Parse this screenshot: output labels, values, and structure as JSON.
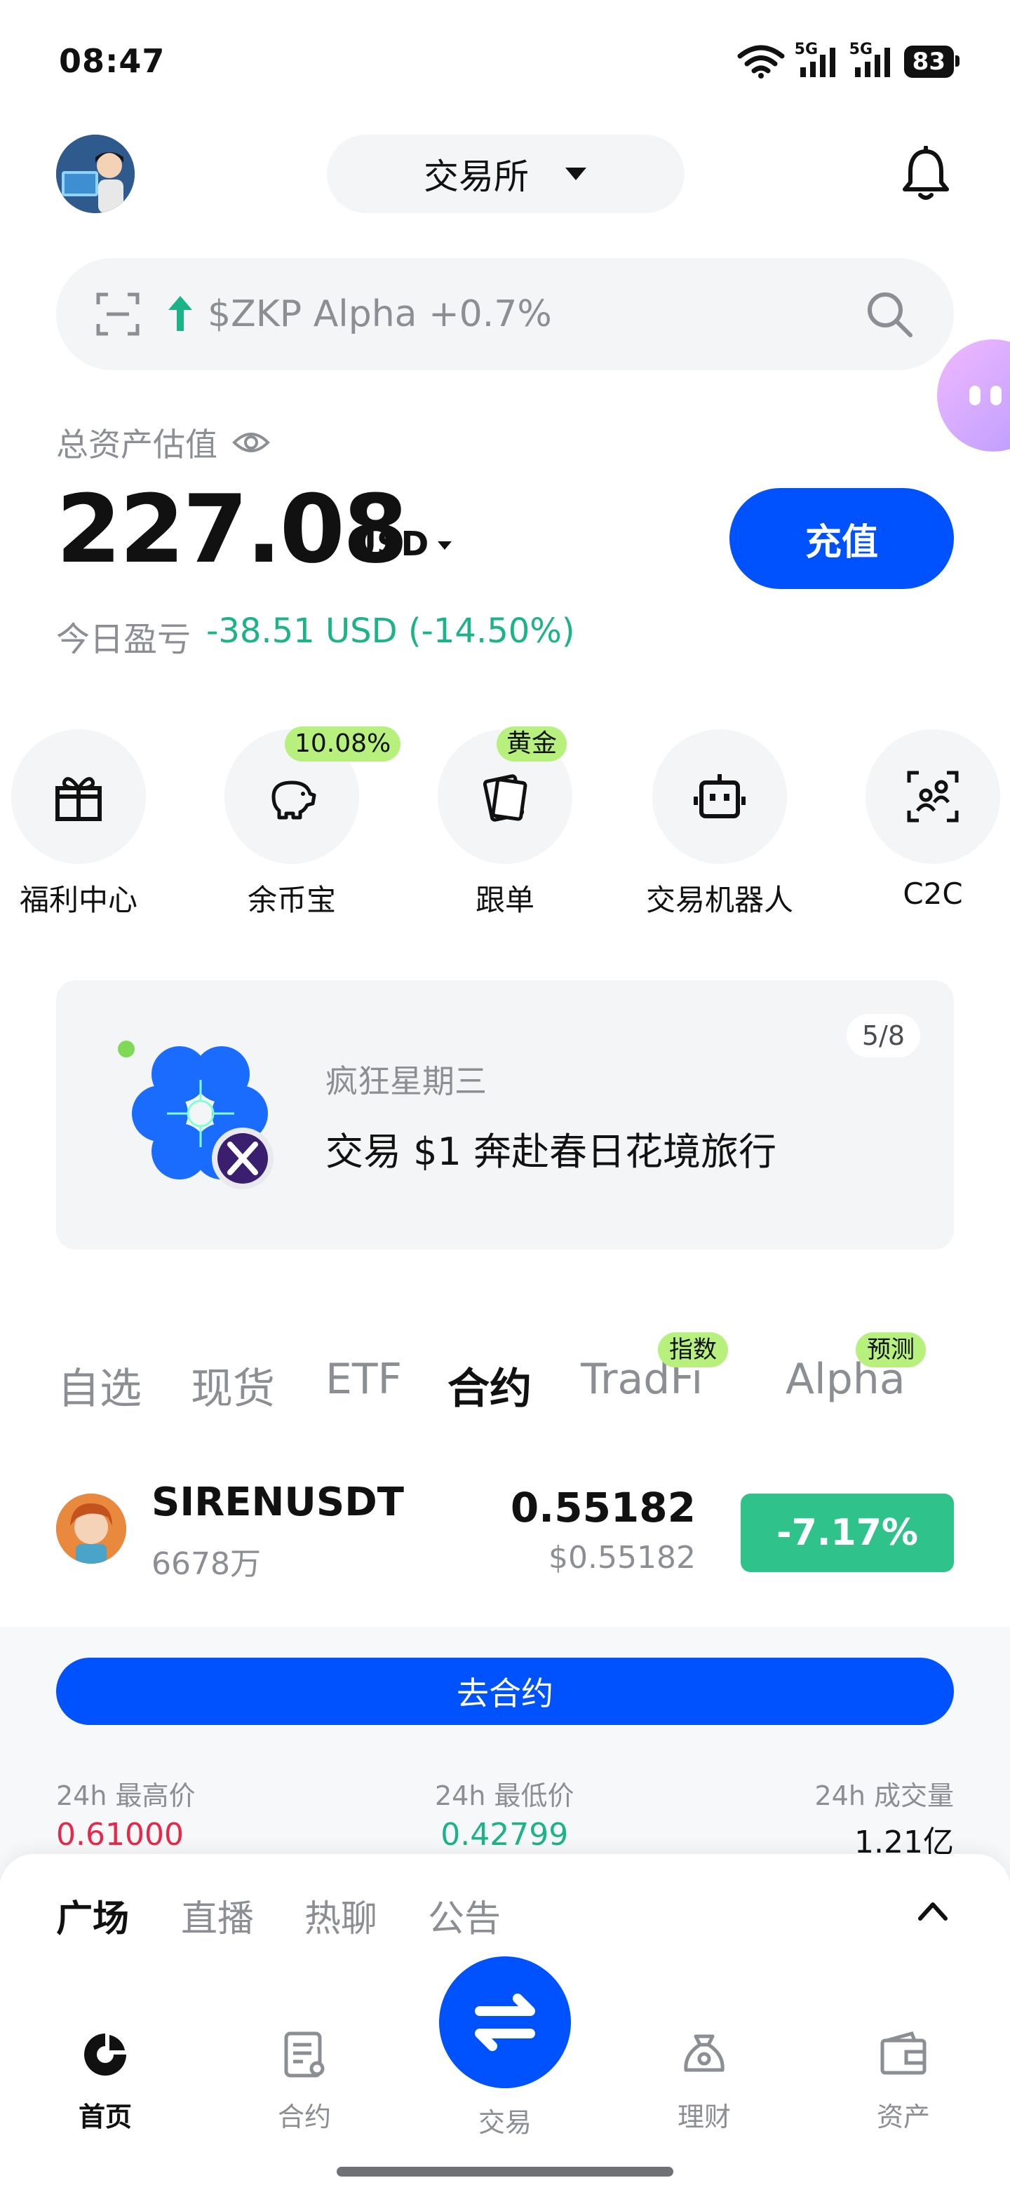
{
  "status_bar": {
    "time": "08:47",
    "network_1": "5G",
    "network_2": "5G",
    "battery": "83"
  },
  "header": {
    "exchange_label": "交易所"
  },
  "search": {
    "text": "$ZKP Alpha +0.7%"
  },
  "assets": {
    "label": "总资产估值",
    "amount": "227.08",
    "unit": "USD",
    "deposit_label": "充值",
    "pnl_label": "今日盈亏",
    "pnl_value": "-38.51 USD (-14.50%)"
  },
  "quick_actions": [
    {
      "label": "福利中心",
      "badge": ""
    },
    {
      "label": "余币宝",
      "badge": "10.08%"
    },
    {
      "label": "跟单",
      "badge": "黄金"
    },
    {
      "label": "交易机器人",
      "badge": ""
    },
    {
      "label": "C2C",
      "badge": ""
    }
  ],
  "banner": {
    "subtitle": "疯狂星期三",
    "title": "交易 $1 奔赴春日花境旅行",
    "page": "5/8"
  },
  "market_tabs": [
    {
      "label": "自选",
      "badge": ""
    },
    {
      "label": "现货",
      "badge": ""
    },
    {
      "label": "ETF",
      "badge": ""
    },
    {
      "label": "合约",
      "badge": ""
    },
    {
      "label": "TradFi",
      "badge": "指数"
    },
    {
      "label": "Alpha",
      "badge": "预测"
    }
  ],
  "market_row": {
    "symbol": "SIRENUSDT",
    "volume": "6678万",
    "price": "0.55182",
    "price_usd": "$0.55182",
    "change": "-7.17%"
  },
  "detail": {
    "goto_label": "去合约",
    "high_label": "24h 最高价",
    "high_value": "0.61000",
    "low_label": "24h 最低价",
    "low_value": "0.42799",
    "vol_label": "24h 成交量",
    "vol_value": "1.21亿"
  },
  "feed_tabs": [
    "广场",
    "直播",
    "热聊",
    "公告"
  ],
  "bottom_nav": [
    "首页",
    "合约",
    "交易",
    "理财",
    "资产"
  ],
  "colors": {
    "brand_blue": "#0052ff",
    "up_green": "#1bb388",
    "down_red": "#e8284a",
    "badge_green": "#b8f07e"
  }
}
